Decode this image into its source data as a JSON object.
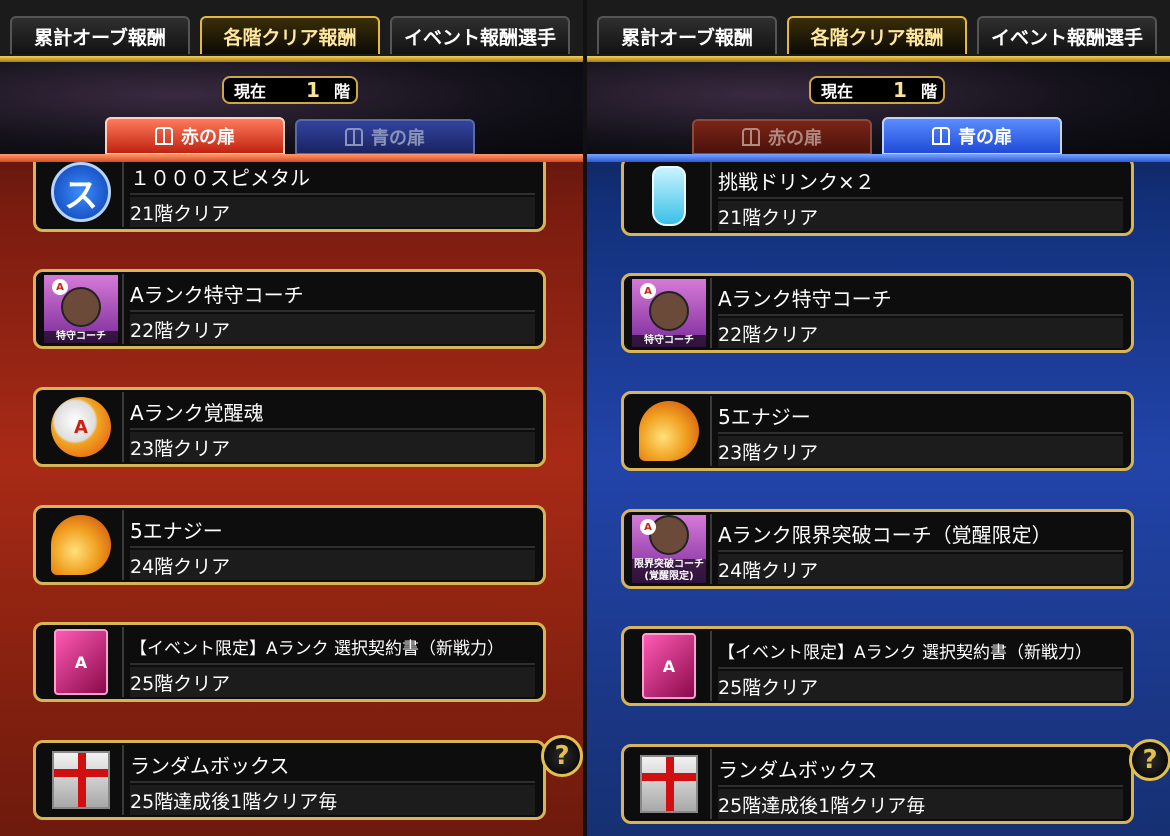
{
  "tabs": [
    "累計オーブ報酬",
    "各階クリア報酬",
    "イベント報酬選手"
  ],
  "floor": {
    "label": "現在",
    "value": "1",
    "unit": "階"
  },
  "doors": {
    "red": "赤の扉",
    "blue": "青の扉"
  },
  "help_symbol": "?",
  "left_items": [
    {
      "icon": "suu-metal-icon",
      "icon_text": "ス",
      "name": "１０００スピメタル",
      "cond": "21階クリア"
    },
    {
      "icon": "coach-icon",
      "icon_text": "特守コーチ",
      "badge": "A",
      "name": "Aランク特守コーチ",
      "cond": "22階クリア"
    },
    {
      "icon": "awakening-soul-icon",
      "icon_text": "A",
      "name": "Aランク覚醒魂",
      "cond": "23階クリア"
    },
    {
      "icon": "energy-icon",
      "name": "5エナジー",
      "cond": "24階クリア"
    },
    {
      "icon": "contract-book-icon",
      "icon_text": "A",
      "name": "【イベント限定】Aランク 選択契約書（新戦力）",
      "cond": "25階クリア"
    },
    {
      "icon": "gift-box-icon",
      "name": "ランダムボックス",
      "cond": "25階達成後1階クリア毎"
    }
  ],
  "right_items": [
    {
      "icon": "drink-bottle-icon",
      "name": "挑戦ドリンク×２",
      "cond": "21階クリア"
    },
    {
      "icon": "coach-icon",
      "icon_text": "特守コーチ",
      "badge": "A",
      "name": "Aランク特守コーチ",
      "cond": "22階クリア"
    },
    {
      "icon": "energy-icon",
      "name": "5エナジー",
      "cond": "23階クリア"
    },
    {
      "icon": "limit-coach-icon",
      "icon_text": "限界突破コーチ (覚醒限定)",
      "badge": "A",
      "name": "Aランク限界突破コーチ（覚醒限定）",
      "cond": "24階クリア"
    },
    {
      "icon": "contract-book-icon",
      "icon_text": "A",
      "name": "【イベント限定】Aランク 選択契約書（新戦力）",
      "cond": "25階クリア"
    },
    {
      "icon": "gift-box-icon",
      "name": "ランダムボックス",
      "cond": "25階達成後1階クリア毎"
    }
  ]
}
